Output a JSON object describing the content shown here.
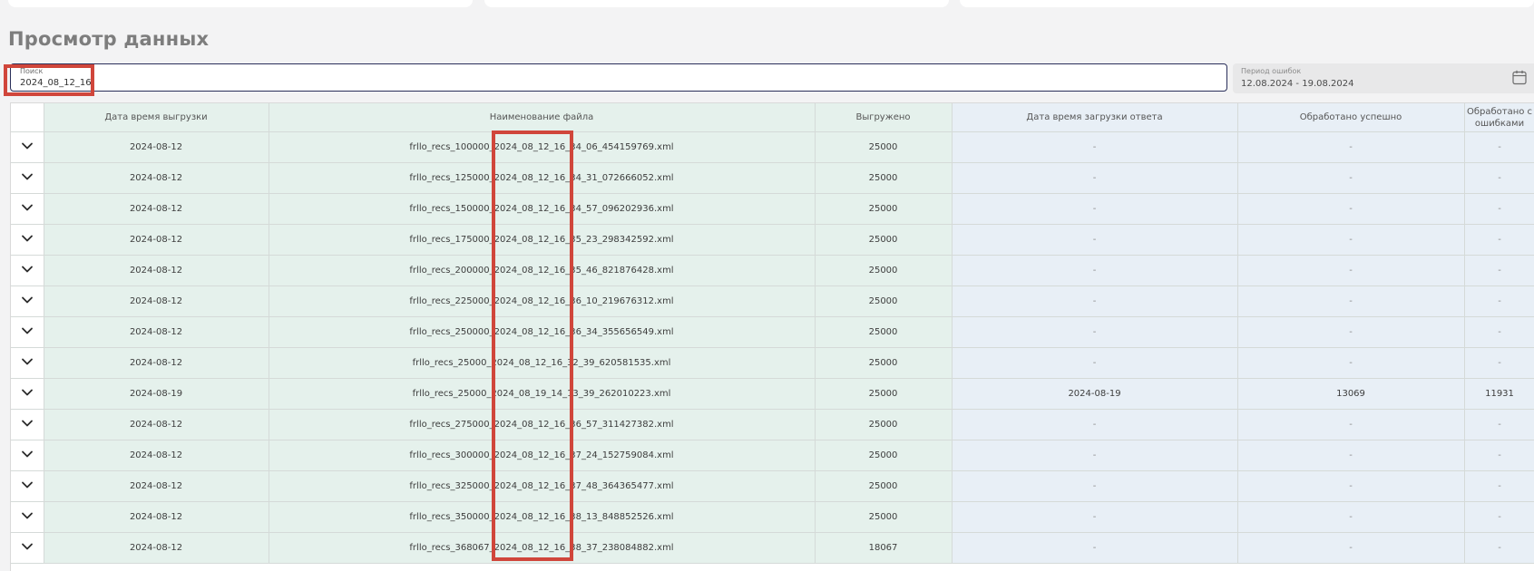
{
  "page": {
    "title": "Просмотр данных"
  },
  "search": {
    "label": "Поиск",
    "value": "2024_08_12_16"
  },
  "period": {
    "label": "Период ошибок",
    "value": "12.08.2024 - 19.08.2024"
  },
  "table": {
    "columns": [
      "Дата время выгрузки",
      "Наименование файла",
      "Выгружено",
      "Дата время загрузки ответа",
      "Обработано успешно",
      "Обработано с ошибками"
    ],
    "rows": [
      {
        "date": "2024-08-12",
        "file": "frllo_recs_100000_2024_08_12_16_34_06_454159769.xml",
        "count": "25000",
        "resp_date": "-",
        "ok": "-",
        "err": "-"
      },
      {
        "date": "2024-08-12",
        "file": "frllo_recs_125000_2024_08_12_16_34_31_072666052.xml",
        "count": "25000",
        "resp_date": "-",
        "ok": "-",
        "err": "-"
      },
      {
        "date": "2024-08-12",
        "file": "frllo_recs_150000_2024_08_12_16_34_57_096202936.xml",
        "count": "25000",
        "resp_date": "-",
        "ok": "-",
        "err": "-"
      },
      {
        "date": "2024-08-12",
        "file": "frllo_recs_175000_2024_08_12_16_35_23_298342592.xml",
        "count": "25000",
        "resp_date": "-",
        "ok": "-",
        "err": "-"
      },
      {
        "date": "2024-08-12",
        "file": "frllo_recs_200000_2024_08_12_16_35_46_821876428.xml",
        "count": "25000",
        "resp_date": "-",
        "ok": "-",
        "err": "-"
      },
      {
        "date": "2024-08-12",
        "file": "frllo_recs_225000_2024_08_12_16_36_10_219676312.xml",
        "count": "25000",
        "resp_date": "-",
        "ok": "-",
        "err": "-"
      },
      {
        "date": "2024-08-12",
        "file": "frllo_recs_250000_2024_08_12_16_36_34_355656549.xml",
        "count": "25000",
        "resp_date": "-",
        "ok": "-",
        "err": "-"
      },
      {
        "date": "2024-08-12",
        "file": "frllo_recs_25000_2024_08_12_16_32_39_620581535.xml",
        "count": "25000",
        "resp_date": "-",
        "ok": "-",
        "err": "-"
      },
      {
        "date": "2024-08-19",
        "file": "frllo_recs_25000_2024_08_19_14_13_39_262010223.xml",
        "count": "25000",
        "resp_date": "2024-08-19",
        "ok": "13069",
        "err": "11931"
      },
      {
        "date": "2024-08-12",
        "file": "frllo_recs_275000_2024_08_12_16_36_57_311427382.xml",
        "count": "25000",
        "resp_date": "-",
        "ok": "-",
        "err": "-"
      },
      {
        "date": "2024-08-12",
        "file": "frllo_recs_300000_2024_08_12_16_37_24_152759084.xml",
        "count": "25000",
        "resp_date": "-",
        "ok": "-",
        "err": "-"
      },
      {
        "date": "2024-08-12",
        "file": "frllo_recs_325000_2024_08_12_16_37_48_364365477.xml",
        "count": "25000",
        "resp_date": "-",
        "ok": "-",
        "err": "-"
      },
      {
        "date": "2024-08-12",
        "file": "frllo_recs_350000_2024_08_12_16_38_13_848852526.xml",
        "count": "25000",
        "resp_date": "-",
        "ok": "-",
        "err": "-"
      },
      {
        "date": "2024-08-12",
        "file": "frllo_recs_368067_2024_08_12_16_38_37_238084882.xml",
        "count": "18067",
        "resp_date": "-",
        "ok": "-",
        "err": "-"
      }
    ]
  },
  "colors": {
    "highlight": "#d0463b",
    "green_cells": "#e5f1ec",
    "blue_cells": "#e8eff6",
    "search_border": "#2a2f5a"
  },
  "icons": {
    "row_toggle": "chevron-down-icon",
    "period": "calendar-icon"
  }
}
